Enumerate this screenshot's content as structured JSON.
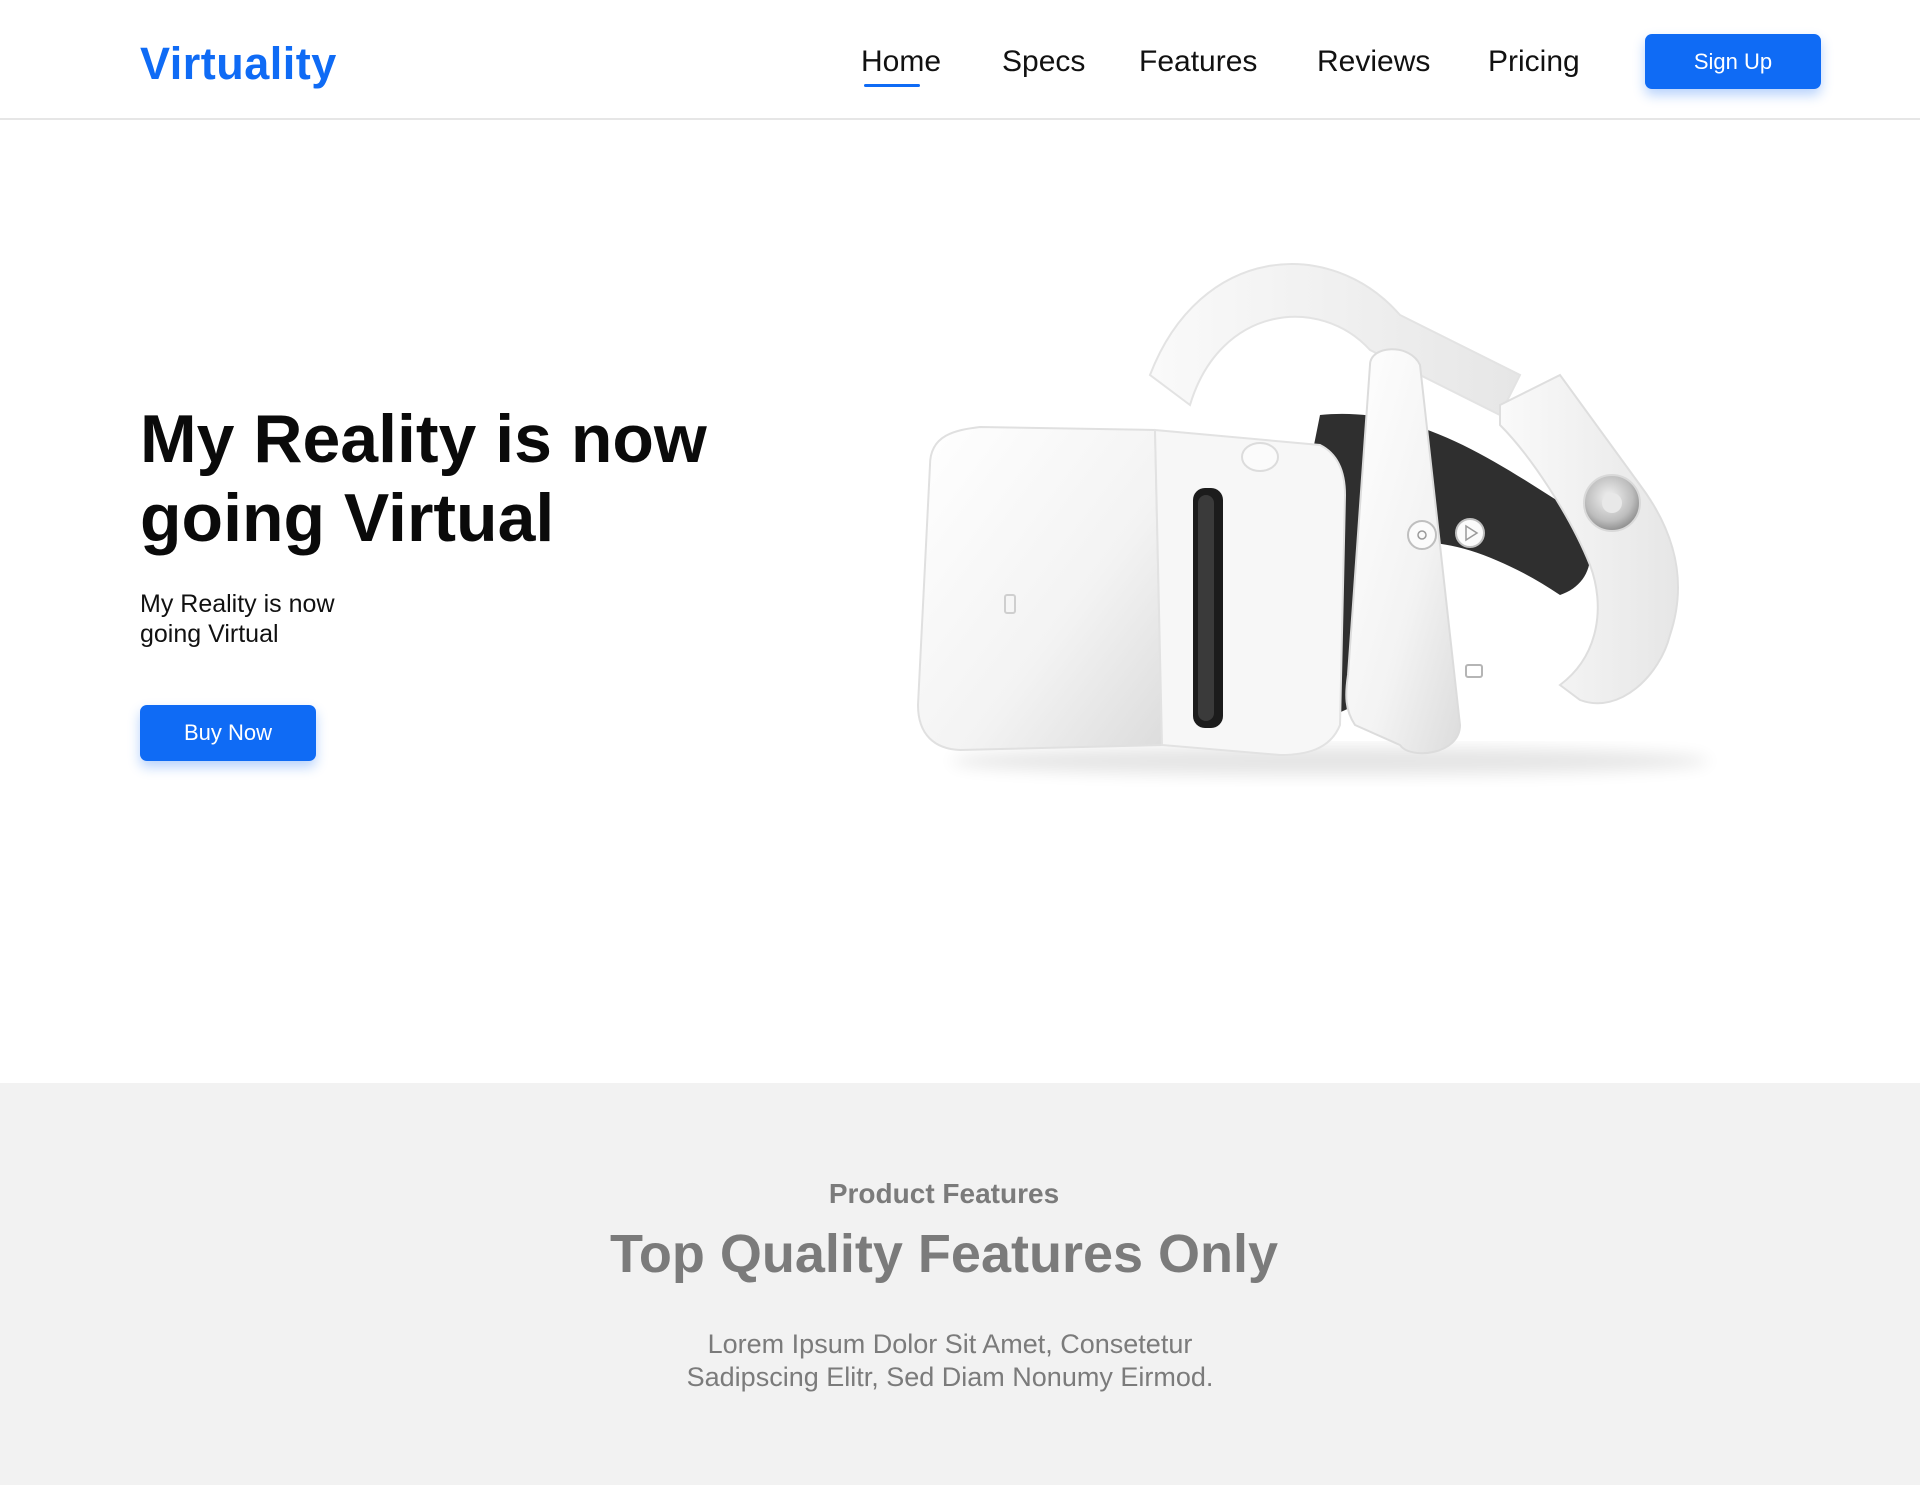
{
  "brand": {
    "name": "Virtuality",
    "color": "#0f6bf5"
  },
  "nav": {
    "items": [
      {
        "label": "Home",
        "active": true
      },
      {
        "label": "Specs",
        "active": false
      },
      {
        "label": "Features",
        "active": false
      },
      {
        "label": "Reviews",
        "active": false
      },
      {
        "label": "Pricing",
        "active": false
      }
    ],
    "signup_label": "Sign Up"
  },
  "hero": {
    "title_line1": "My Reality is now",
    "title_line2": "going Virtual",
    "subtitle_line1": "My Reality is now",
    "subtitle_line2": "going Virtual",
    "cta_label": "Buy Now",
    "image_icon": "vr-headset-with-controller-image"
  },
  "features": {
    "label": "Product Features",
    "title": "Top Quality Features Only",
    "desc_line1": "Lorem Ipsum Dolor Sit Amet, Consetetur",
    "desc_line2": "Sadipscing Elitr, Sed Diam Nonumy Eirmod."
  }
}
